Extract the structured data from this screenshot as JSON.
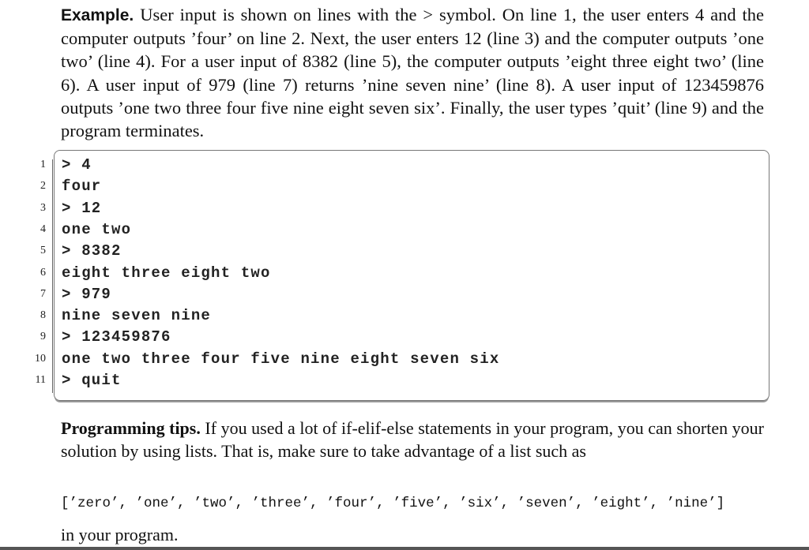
{
  "example": {
    "heading": "Example.",
    "text": "User input is shown on lines with the > symbol. On line 1, the user enters 4 and the computer outputs ’four’ on line 2. Next, the user enters 12 (line 3) and the computer outputs ’one two’ (line 4). For a user input of 8382 (line 5), the computer outputs ’eight three eight two’ (line 6). A user input of 979 (line 7) returns ’nine seven nine’ (line 8). A user input of 123459876 outputs ’one two three four five nine eight seven six’. Finally, the user types ’quit’ (line 9) and the program terminates."
  },
  "code_listing": {
    "lines": [
      {
        "num": "1",
        "text": "> 4"
      },
      {
        "num": "2",
        "text": "four"
      },
      {
        "num": "3",
        "text": "> 12"
      },
      {
        "num": "4",
        "text": "one two"
      },
      {
        "num": "5",
        "text": "> 8382"
      },
      {
        "num": "6",
        "text": "eight three eight two"
      },
      {
        "num": "7",
        "text": "> 979"
      },
      {
        "num": "8",
        "text": "nine seven nine"
      },
      {
        "num": "9",
        "text": "> 123459876"
      },
      {
        "num": "10",
        "text": "one two three four five nine eight seven six"
      },
      {
        "num": "11",
        "text": "> quit"
      }
    ]
  },
  "tips": {
    "heading": "Programming tips.",
    "text": "If you used a lot of if-elif-else statements in your program, you can shorten your solution by using lists. That is, make sure to take advantage of a list such as",
    "list_code": "[’zero’, ’one’, ’two’, ’three’, ’four’, ’five’, ’six’, ’seven’, ’eight’, ’nine’]",
    "closing": "in your program."
  }
}
